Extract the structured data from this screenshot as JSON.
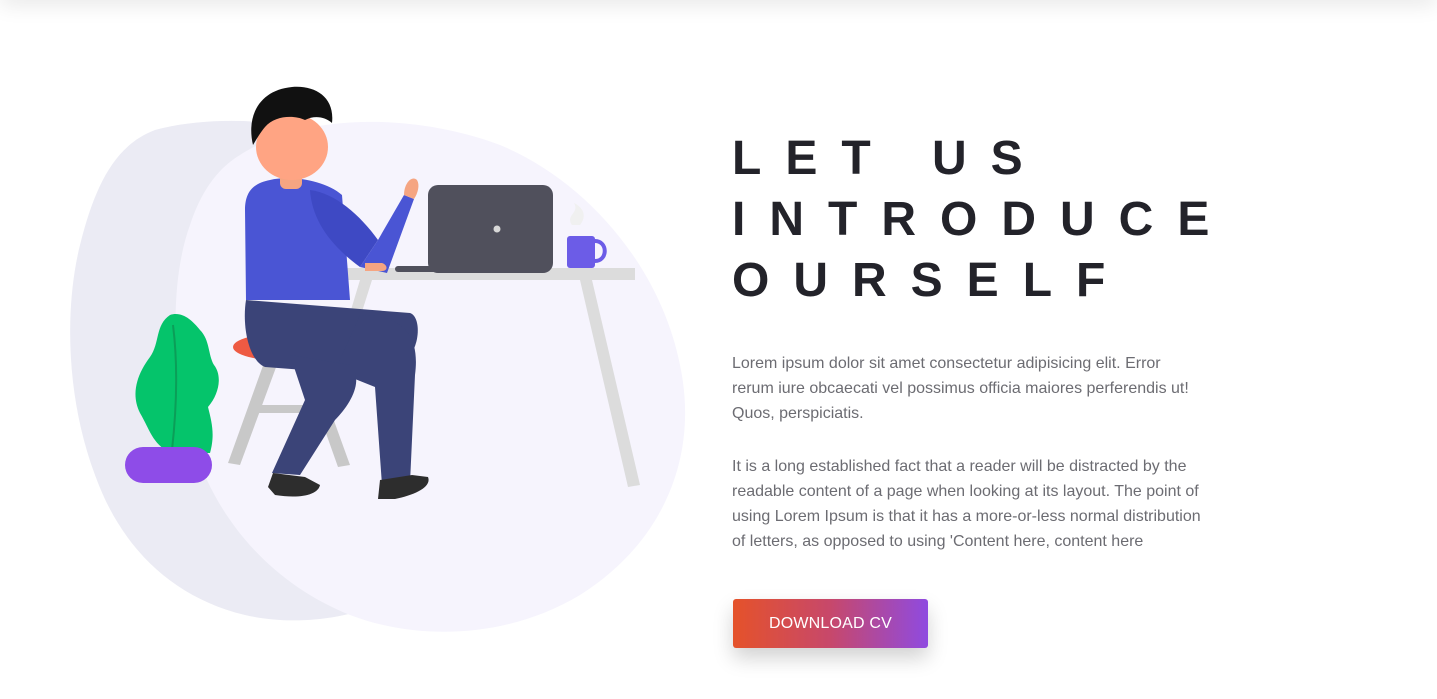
{
  "hero": {
    "headline_lines": [
      "LET US",
      "INTRODUCE",
      "OURSELF"
    ],
    "paragraph_1": "Lorem ipsum dolor sit amet consectetur adipisicing elit. Error rerum iure obcaecati vel possimus officia maiores perferendis ut! Quos, perspiciatis.",
    "paragraph_2": "It is a long established fact that a reader will be distracted by the readable content of a page when looking at its layout. The point of using Lorem Ipsum is that it has a more-or-less normal distribution of letters, as opposed to using 'Content here, content here",
    "cta_label": "DOWNLOAD CV"
  },
  "colors": {
    "heading": "#23232a",
    "body_text": "#6c6c72",
    "cta_gradient_start": "#e5522a",
    "cta_gradient_end": "#8f4ae0",
    "illustration_shirt": "#4a55d4",
    "illustration_pants": "#3b4478",
    "illustration_plant": "#05c46b",
    "illustration_pot": "#8e4ce8"
  },
  "icons": {
    "illustration": "person-working-at-laptop-illustration"
  }
}
